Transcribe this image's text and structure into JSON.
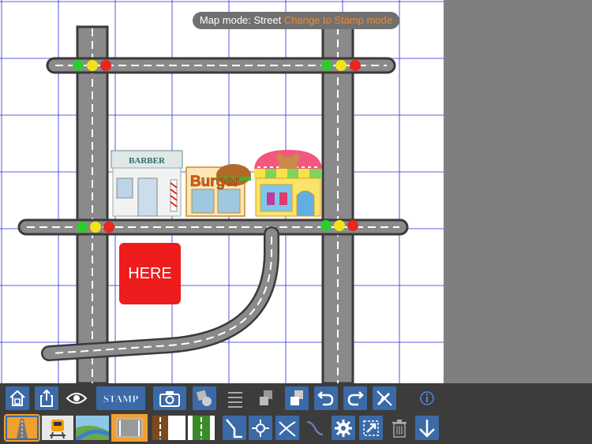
{
  "mode_bar": {
    "status": "Map mode: Street",
    "action": "Change to Stamp mode"
  },
  "map": {
    "marker_label": "HERE",
    "stamps": {
      "barber_sign": "BARBER",
      "burger_sign": "Burger"
    }
  },
  "toolbar": {
    "row1": [
      "home-icon",
      "share-icon",
      "eye-icon",
      "stamp-icon",
      "camera-icon",
      "shapes-icon",
      "list-icon",
      "layers-icon",
      "layer-order-icon",
      "undo-icon",
      "redo-icon",
      "no-edit-icon",
      "info-icon"
    ],
    "row2": [
      "road-icon",
      "train-icon",
      "river-icon",
      "street-tile-icon",
      "brown-path-icon",
      "green-path-icon",
      "connect-corner-icon",
      "node-point-icon",
      "cross-icon",
      "curve-icon",
      "gear-icon",
      "expand-icon",
      "trash-icon",
      "arrow-down-icon"
    ],
    "stamp_label": "STAMP"
  },
  "colors": {
    "canvas_bg": "#ffffff",
    "grid": "#2a2ae0",
    "road": "#8a8a8a",
    "road_edge": "#3a3a3a",
    "toolbar": "#3c3c3c",
    "button": "#3b6aa8",
    "selected": "#f0a030",
    "here": "#ee1c1c"
  }
}
